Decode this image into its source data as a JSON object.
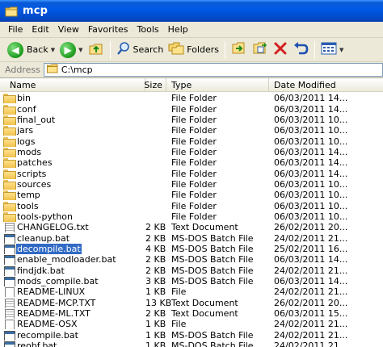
{
  "window": {
    "title": "mcp"
  },
  "menu": [
    "File",
    "Edit",
    "View",
    "Favorites",
    "Tools",
    "Help"
  ],
  "toolbar": {
    "back_label": "Back",
    "search_label": "Search",
    "folders_label": "Folders"
  },
  "address": {
    "label": "Address",
    "value": "C:\\mcp"
  },
  "columns": {
    "name": "Name",
    "size": "Size",
    "type": "Type",
    "date": "Date Modified"
  },
  "colors": {
    "titlebar": "#0058e5",
    "selection": "#316ac5",
    "folder": "#f0c24d"
  },
  "files": [
    {
      "name": "bin",
      "size": "",
      "type": "File Folder",
      "date": "06/03/2011 14...",
      "icon": "folder-icon"
    },
    {
      "name": "conf",
      "size": "",
      "type": "File Folder",
      "date": "06/03/2011 14...",
      "icon": "folder-icon"
    },
    {
      "name": "final_out",
      "size": "",
      "type": "File Folder",
      "date": "06/03/2011 10...",
      "icon": "folder-icon"
    },
    {
      "name": "jars",
      "size": "",
      "type": "File Folder",
      "date": "06/03/2011 10...",
      "icon": "folder-icon"
    },
    {
      "name": "logs",
      "size": "",
      "type": "File Folder",
      "date": "06/03/2011 10...",
      "icon": "folder-icon"
    },
    {
      "name": "mods",
      "size": "",
      "type": "File Folder",
      "date": "06/03/2011 14...",
      "icon": "folder-icon"
    },
    {
      "name": "patches",
      "size": "",
      "type": "File Folder",
      "date": "06/03/2011 14...",
      "icon": "folder-icon"
    },
    {
      "name": "scripts",
      "size": "",
      "type": "File Folder",
      "date": "06/03/2011 14...",
      "icon": "folder-icon"
    },
    {
      "name": "sources",
      "size": "",
      "type": "File Folder",
      "date": "06/03/2011 10...",
      "icon": "folder-icon"
    },
    {
      "name": "temp",
      "size": "",
      "type": "File Folder",
      "date": "06/03/2011 10...",
      "icon": "folder-icon"
    },
    {
      "name": "tools",
      "size": "",
      "type": "File Folder",
      "date": "06/03/2011 10...",
      "icon": "folder-icon"
    },
    {
      "name": "tools-python",
      "size": "",
      "type": "File Folder",
      "date": "06/03/2011 10...",
      "icon": "folder-icon"
    },
    {
      "name": "CHANGELOG.txt",
      "size": "2 KB",
      "type": "Text Document",
      "date": "26/02/2011 20...",
      "icon": "text-document-icon"
    },
    {
      "name": "cleanup.bat",
      "size": "2 KB",
      "type": "MS-DOS Batch File",
      "date": "24/02/2011 21...",
      "icon": "batch-file-icon"
    },
    {
      "name": "decompile.bat",
      "size": "4 KB",
      "type": "MS-DOS Batch File",
      "date": "25/02/2011 16...",
      "icon": "batch-file-icon"
    },
    {
      "name": "enable_modloader.bat",
      "size": "2 KB",
      "type": "MS-DOS Batch File",
      "date": "06/03/2011 14...",
      "icon": "batch-file-icon"
    },
    {
      "name": "findjdk.bat",
      "size": "2 KB",
      "type": "MS-DOS Batch File",
      "date": "24/02/2011 21...",
      "icon": "batch-file-icon"
    },
    {
      "name": "mods_compile.bat",
      "size": "3 KB",
      "type": "MS-DOS Batch File",
      "date": "06/03/2011 14...",
      "icon": "batch-file-icon"
    },
    {
      "name": "README-LINUX",
      "size": "1 KB",
      "type": "File",
      "date": "24/02/2011 21...",
      "icon": "file-icon"
    },
    {
      "name": "README-MCP.TXT",
      "size": "13 KB",
      "type": "Text Document",
      "date": "26/02/2011 20...",
      "icon": "text-document-icon"
    },
    {
      "name": "README-ML.TXT",
      "size": "2 KB",
      "type": "Text Document",
      "date": "06/03/2011 15...",
      "icon": "text-document-icon"
    },
    {
      "name": "README-OSX",
      "size": "1 KB",
      "type": "File",
      "date": "24/02/2011 21...",
      "icon": "file-icon"
    },
    {
      "name": "recompile.bat",
      "size": "1 KB",
      "type": "MS-DOS Batch File",
      "date": "24/02/2011 21...",
      "icon": "batch-file-icon"
    },
    {
      "name": "reobf.bat",
      "size": "1 KB",
      "type": "MS-DOS Batch File",
      "date": "24/02/2011 21...",
      "icon": "batch-file-icon"
    }
  ],
  "selected_index": 14
}
